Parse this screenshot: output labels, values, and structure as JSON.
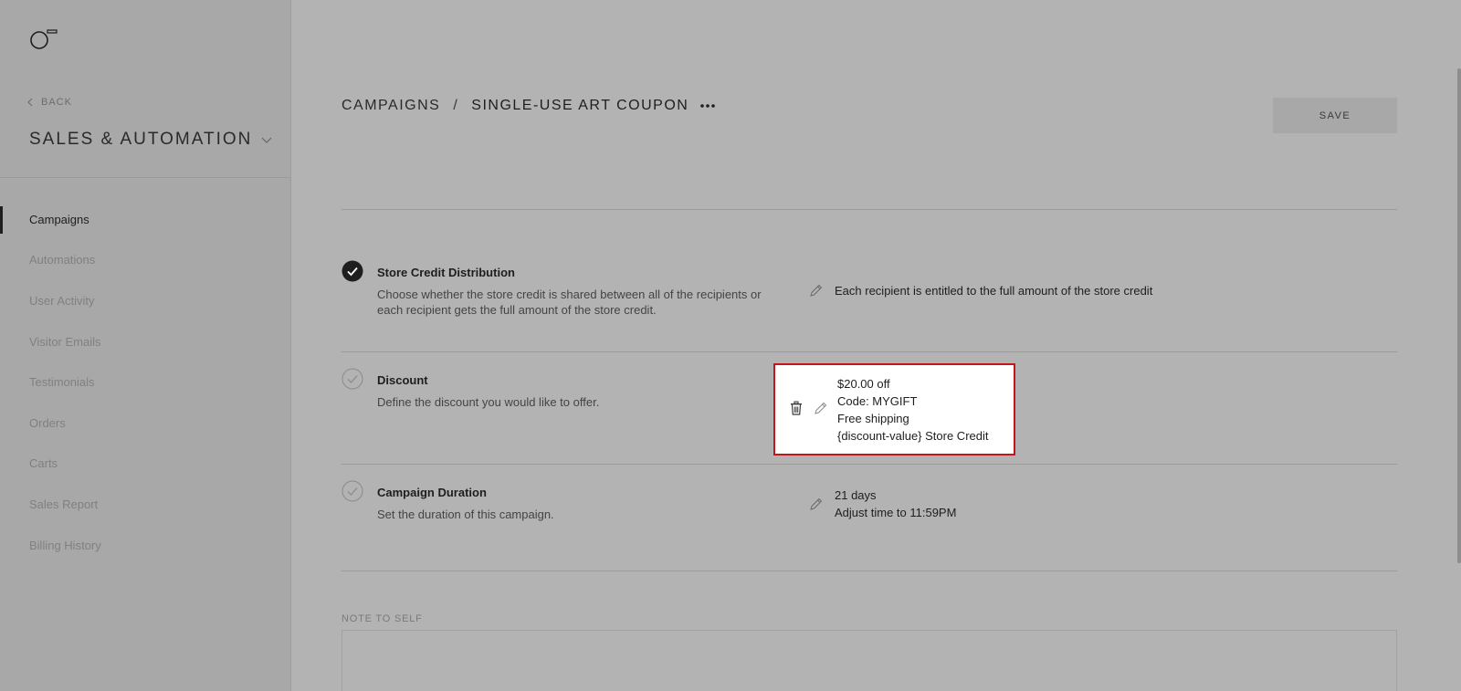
{
  "sidebar": {
    "back_label": "BACK",
    "section_title": "SALES & AUTOMATION",
    "items": [
      {
        "label": "Campaigns"
      },
      {
        "label": "Automations"
      },
      {
        "label": "User Activity"
      },
      {
        "label": "Visitor Emails"
      },
      {
        "label": "Testimonials"
      },
      {
        "label": "Orders"
      },
      {
        "label": "Carts"
      },
      {
        "label": "Sales Report"
      },
      {
        "label": "Billing History"
      }
    ],
    "active_index": 0
  },
  "header": {
    "breadcrumb_root": "CAMPAIGNS",
    "breadcrumb_sep": "/",
    "breadcrumb_current": "SINGLE-USE ART COUPON",
    "save_label": "SAVE"
  },
  "rows": {
    "store_credit": {
      "title": "Store Credit Distribution",
      "desc": "Choose whether the store credit is shared between all of the recipients or each recipient gets the full amount of the store credit.",
      "value": "Each recipient is entitled to the full amount of the store credit",
      "completed": true
    },
    "discount": {
      "title": "Discount",
      "desc": "Define the discount you would like to offer.",
      "lines": [
        "$20.00 off",
        "Code: MYGIFT",
        "Free shipping",
        "{discount-value} Store Credit"
      ],
      "completed": false
    },
    "duration": {
      "title": "Campaign Duration",
      "desc": "Set the duration of this campaign.",
      "lines": [
        "21 days",
        "Adjust time to 11:59PM"
      ],
      "completed": false
    }
  },
  "note": {
    "label": "NOTE TO SELF",
    "value": ""
  },
  "colors": {
    "highlight_border": "#c0161c",
    "overlay_bg": "#b3b3b3",
    "sidebar_bg": "#a8a8a8"
  }
}
